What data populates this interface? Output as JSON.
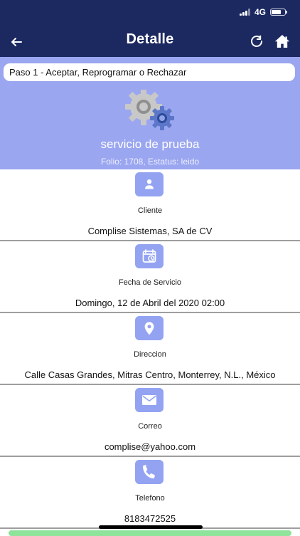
{
  "status_bar": {
    "network": "4G"
  },
  "header": {
    "title": "Detalle",
    "back_icon": "arrow-left-icon",
    "refresh_icon": "refresh-icon",
    "home_icon": "home-icon",
    "background": "#1c2961"
  },
  "hero": {
    "step": "Paso 1 - Aceptar, Reprogramar o Rechazar",
    "service_name": "servicio de prueba",
    "meta": "Folio: 1708, Estatus: leido",
    "icon": "gears-icon",
    "background": "#9aa6f0"
  },
  "sections": [
    {
      "icon": "user-icon",
      "label": "Cliente",
      "value": "Complise Sistemas, SA de CV"
    },
    {
      "icon": "calendar-clock-icon",
      "label": "Fecha de Servicio",
      "value": "Domingo, 12 de Abril del 2020 02:00"
    },
    {
      "icon": "location-pin-icon",
      "label": "Direccion",
      "value": "Calle Casas Grandes, Mitras Centro, Monterrey, N.L., México"
    },
    {
      "icon": "envelope-icon",
      "label": "Correo",
      "value": "complise@yahoo.com"
    },
    {
      "icon": "phone-icon",
      "label": "Telefono",
      "value": "8183472525"
    }
  ],
  "colors": {
    "accent_icon_bg": "#93a3f2",
    "divider": "#9e9e9e",
    "bottom_button": "#8fe39a"
  }
}
